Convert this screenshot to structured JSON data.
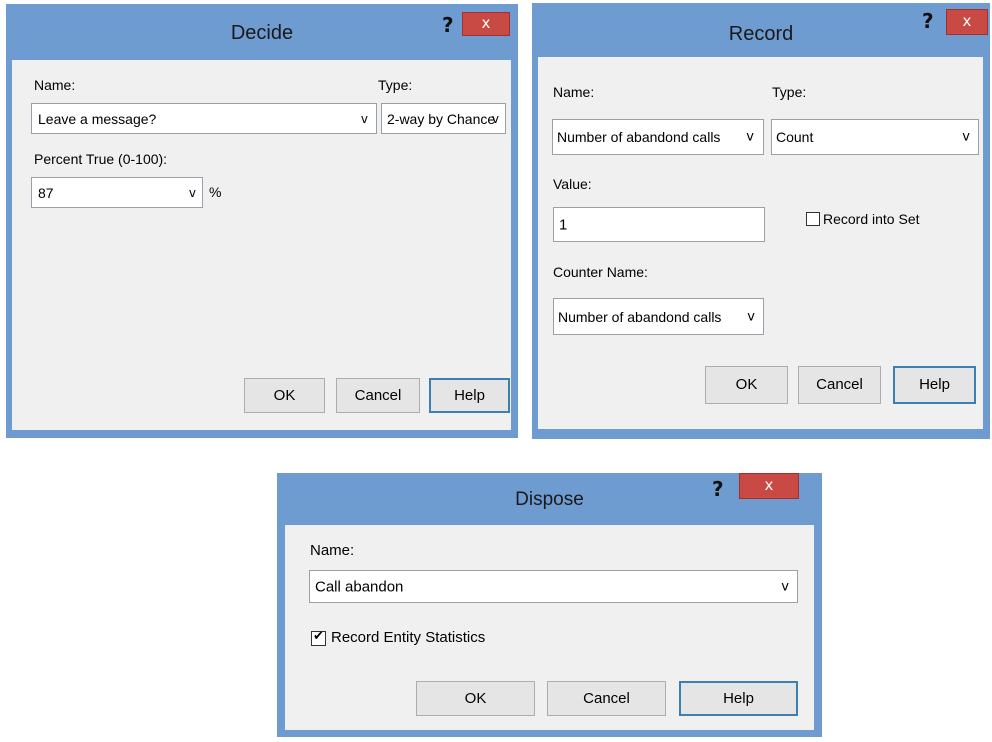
{
  "decide": {
    "title": "Decide",
    "help_glyph": "?",
    "close_glyph": "x",
    "name_label": "Name:",
    "type_label": "Type:",
    "name_value": "Leave a message?",
    "type_value": "2-way by Chance",
    "percent_label": "Percent True (0-100):",
    "percent_value": "87",
    "percent_unit": "%",
    "ok": "OK",
    "cancel": "Cancel",
    "help": "Help"
  },
  "record": {
    "title": "Record",
    "help_glyph": "?",
    "close_glyph": "x",
    "name_label": "Name:",
    "type_label": "Type:",
    "name_value": "Number of abandond calls",
    "type_value": "Count",
    "value_label": "Value:",
    "value_value": "1",
    "record_into_set": "Record into Set",
    "counter_label": "Counter Name:",
    "counter_value": "Number of abandond calls",
    "ok": "OK",
    "cancel": "Cancel",
    "help": "Help"
  },
  "dispose": {
    "title": "Dispose",
    "help_glyph": "?",
    "close_glyph": "x",
    "name_label": "Name:",
    "name_value": "Call abandon",
    "record_stats": "Record Entity Statistics",
    "checkmark": "✔",
    "ok": "OK",
    "cancel": "Cancel",
    "help": "Help"
  },
  "icons": {
    "dropdown": "chevron-down-icon"
  },
  "colors": {
    "frame": "#6e9bd0",
    "close": "#c94a44",
    "client": "#f0f0f0",
    "focus_border": "#3c7fb1"
  }
}
